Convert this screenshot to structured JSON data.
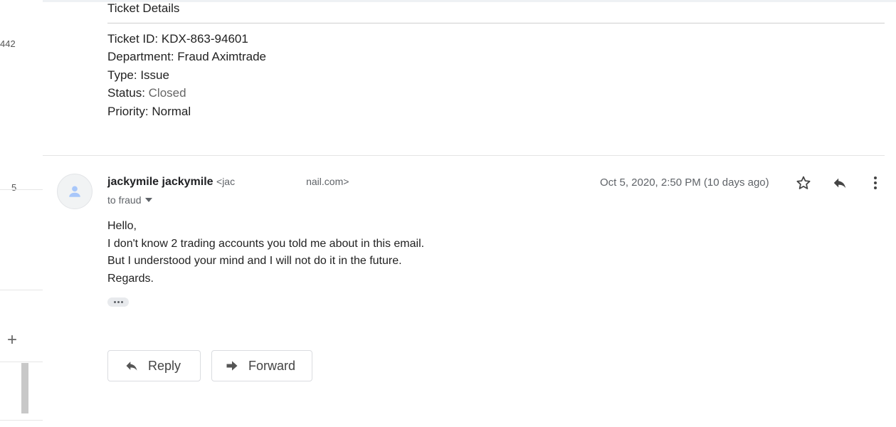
{
  "left_gutter": {
    "number_top": "442",
    "number_mid": "5",
    "plus_symbol": "+"
  },
  "ticket": {
    "title": "Ticket Details",
    "id_label": "Ticket ID:",
    "id_value": "KDX-863-94601",
    "department_label": "Department:",
    "department_value": "Fraud Aximtrade",
    "type_label": "Type:",
    "type_value": "Issue",
    "status_label": "Status:",
    "status_value": "Closed",
    "priority_label": "Priority:",
    "priority_value": "Normal"
  },
  "message": {
    "sender_name": "jackymile jackymile",
    "email_start": "<jac",
    "email_end": "nail.com>",
    "to_text": "to fraud",
    "date": "Oct 5, 2020, 2:50 PM (10 days ago)",
    "body": [
      "Hello,",
      "I don't know 2 trading accounts you told me about in this email.",
      "But I understood your mind and I will not do it in the future.",
      "Regards."
    ]
  },
  "actions": {
    "reply_label": "Reply",
    "forward_label": "Forward"
  },
  "icons": {
    "star": "star-icon",
    "reply": "reply-icon",
    "more": "more-vert-icon",
    "forward": "forward-arrow-icon",
    "avatar": "person-icon"
  },
  "colors": {
    "muted_text": "#5f6368",
    "border": "#dadce0",
    "avatar_bg": "#f1f3f4",
    "avatar_icon": "#a8c7fa"
  }
}
